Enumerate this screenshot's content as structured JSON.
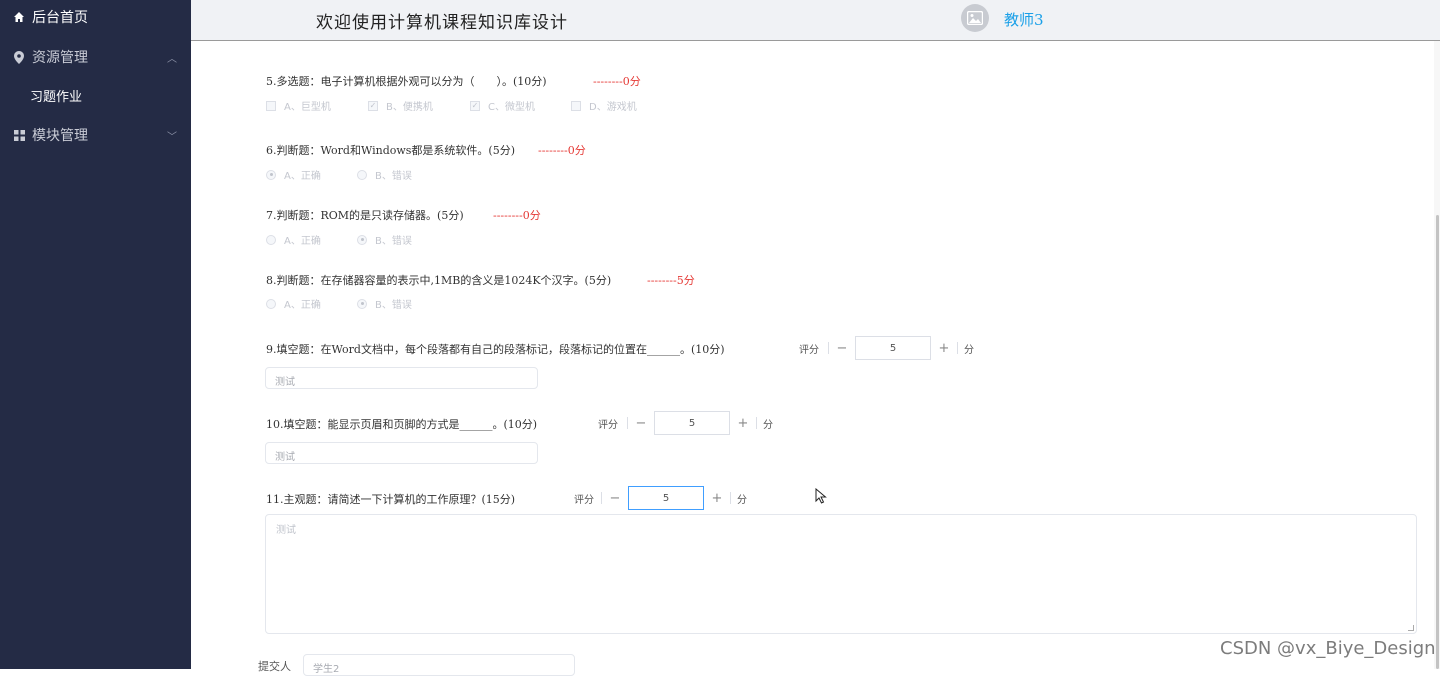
{
  "sidebar": {
    "home_label": "后台首页",
    "resource_label": "资源管理",
    "resource_sub_label": "习题作业",
    "module_label": "模块管理"
  },
  "header": {
    "title": "欢迎使用计算机课程知识库设计",
    "user_name": "教师3"
  },
  "questions": [
    {
      "text": "5.多选题：电子计算机根据外观可以分为（　　）。(10分)",
      "result": "--------0分",
      "options": [
        {
          "label": "A、巨型机",
          "checked": false
        },
        {
          "label": "B、便携机",
          "checked": true
        },
        {
          "label": "C、微型机",
          "checked": true
        },
        {
          "label": "D、游戏机",
          "checked": false
        }
      ]
    },
    {
      "text": "6.判断题：Word和Windows都是系统软件。(5分)",
      "result": "--------0分",
      "options": [
        {
          "label": "A、正确",
          "checked": true
        },
        {
          "label": "B、错误",
          "checked": false
        }
      ]
    },
    {
      "text": "7.判断题：ROM的是只读存储器。(5分)",
      "result": "--------0分",
      "options": [
        {
          "label": "A、正确",
          "checked": false
        },
        {
          "label": "B、错误",
          "checked": true
        }
      ]
    },
    {
      "text": "8.判断题：在存储器容量的表示中,1MB的含义是1024K个汉字。(5分)",
      "result": "--------5分",
      "options": [
        {
          "label": "A、正确",
          "checked": false
        },
        {
          "label": "B、错误",
          "checked": true
        }
      ]
    },
    {
      "text": "9.填空题：在Word文档中，每个段落都有自己的段落标记，段落标记的位置在______。(10分)",
      "score_label": "评分",
      "score": "5",
      "unit": "分",
      "answer": "测试"
    },
    {
      "text": "10.填空题：能显示页眉和页脚的方式是______。(10分)",
      "score_label": "评分",
      "score": "5",
      "unit": "分",
      "answer": "测试"
    },
    {
      "text": "11.主观题：请简述一下计算机的工作原理？(15分)",
      "score_label": "评分",
      "score": "5",
      "unit": "分",
      "answer": "测试"
    }
  ],
  "stepper": {
    "minus": "−",
    "plus": "+"
  },
  "submitter": {
    "label": "提交人",
    "value": "学生2"
  },
  "watermark": "CSDN @vx_Biye_Design",
  "colors": {
    "sidebar_bg": "#242b45",
    "accent": "#1aa0e8",
    "result_red": "#e53935",
    "focus": "#409eff"
  }
}
